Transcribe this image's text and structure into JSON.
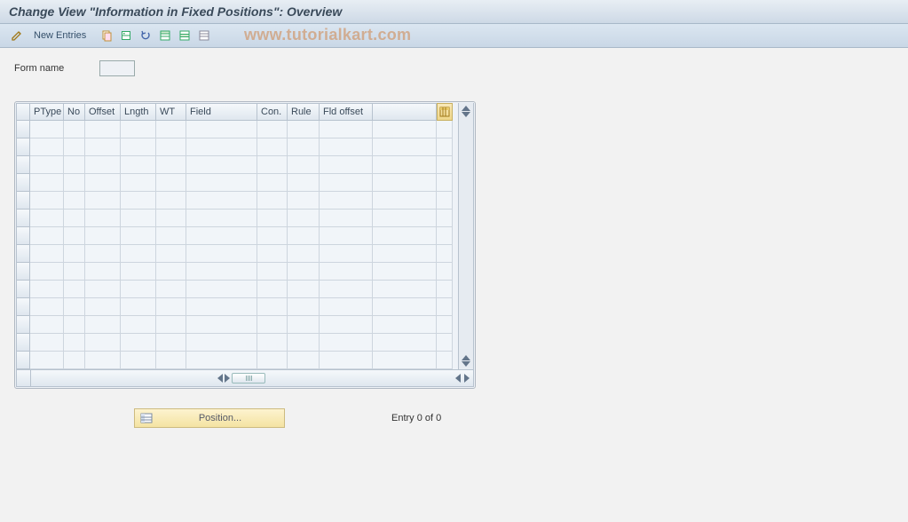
{
  "title": "Change View \"Information in Fixed Positions\": Overview",
  "toolbar": {
    "new_entries_label": "New Entries",
    "icons": {
      "edit": "edit-icon",
      "copy": "copy-icon",
      "save_variant": "save-variant-icon",
      "undo": "undo-icon",
      "select_all": "select-all-icon",
      "select_block": "select-block-icon",
      "deselect_all": "deselect-all-icon"
    }
  },
  "watermark": "www.tutorialkart.com",
  "form": {
    "name_label": "Form name",
    "name_value": ""
  },
  "table": {
    "columns": [
      {
        "key": "ptype",
        "label": "PType"
      },
      {
        "key": "no",
        "label": "No"
      },
      {
        "key": "offset",
        "label": "Offset"
      },
      {
        "key": "lngth",
        "label": "Lngth"
      },
      {
        "key": "wt",
        "label": "WT"
      },
      {
        "key": "field",
        "label": "Field"
      },
      {
        "key": "con",
        "label": "Con."
      },
      {
        "key": "rule",
        "label": "Rule"
      },
      {
        "key": "fldoff",
        "label": "Fld offset"
      }
    ],
    "rows": [],
    "visible_row_count": 14
  },
  "footer": {
    "position_label": "Position...",
    "entry_text": "Entry 0 of 0"
  }
}
